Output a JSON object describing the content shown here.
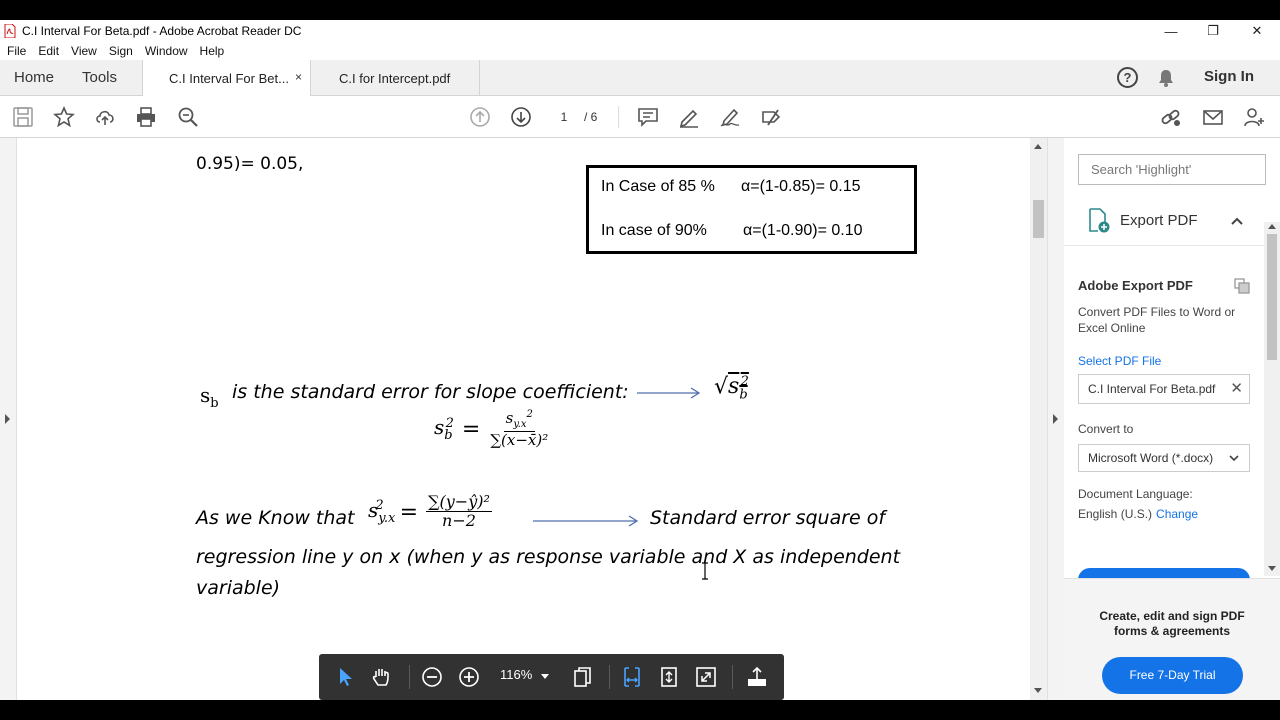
{
  "window": {
    "title": "C.I Interval For Beta.pdf - Adobe Acrobat Reader DC",
    "minimize": "—",
    "maximize": "❐",
    "close": "✕"
  },
  "menu": [
    "File",
    "Edit",
    "View",
    "Sign",
    "Window",
    "Help"
  ],
  "tabs": {
    "home": "Home",
    "tools": "Tools",
    "active_doc": "C.I Interval For Bet...",
    "active_close": "×",
    "other_doc": "C.I for Intercept.pdf",
    "help_glyph": "?",
    "signin": "Sign In"
  },
  "toolbar": {
    "page_current": "1",
    "page_total": "/ 6"
  },
  "document": {
    "top_fragment": "0.95)= 0.05,",
    "box_row1_left": "In Case of 85 %",
    "box_row1_right": "α=(1-0.85)= 0.15",
    "box_row2_left": "In case of 90%",
    "box_row2_right": "α=(1-0.90)= 0.10",
    "sb_symbol": "s",
    "sb_sub": "b",
    "sb_text": "is the standard error for slope coefficient:",
    "sqrt_sym": "√",
    "s": "s",
    "b": "b",
    "two": "2",
    "eq_sign": "=",
    "f1_num_s": "s",
    "f1_num_sub": "y.x",
    "f1_den": "∑(x−x̄)²",
    "line2_a": "As we Know that",
    "f2_lhs_sub": "y.x",
    "f2_num": "∑(y−ŷ)²",
    "f2_den": "n−2",
    "line2_b": "Standard error square of",
    "line3": "regression line y on x   (when y as response  variable and X as independent",
    "line4": "variable)"
  },
  "floatbar": {
    "zoom": "116%"
  },
  "right_panel": {
    "search_placeholder": "Search 'Highlight'",
    "export_label": "Export PDF",
    "title": "Adobe Export PDF",
    "description": "Convert PDF Files to Word or Excel Online",
    "select_label": "Select PDF File",
    "file_name": "C.I Interval For Beta.pdf",
    "file_clear": "✕",
    "convert_label": "Convert to",
    "convert_value": "Microsoft Word (*.docx)",
    "lang_label": "Document Language:",
    "lang_value": "English (U.S.)",
    "lang_change": "Change",
    "promo_text": "Create, edit and sign PDF forms & agreements",
    "trial_button": "Free 7-Day Trial"
  },
  "colors": {
    "accent_blue": "#1473e6",
    "arrow_blue": "#4f6fae",
    "floatbar_bg": "#323232"
  }
}
